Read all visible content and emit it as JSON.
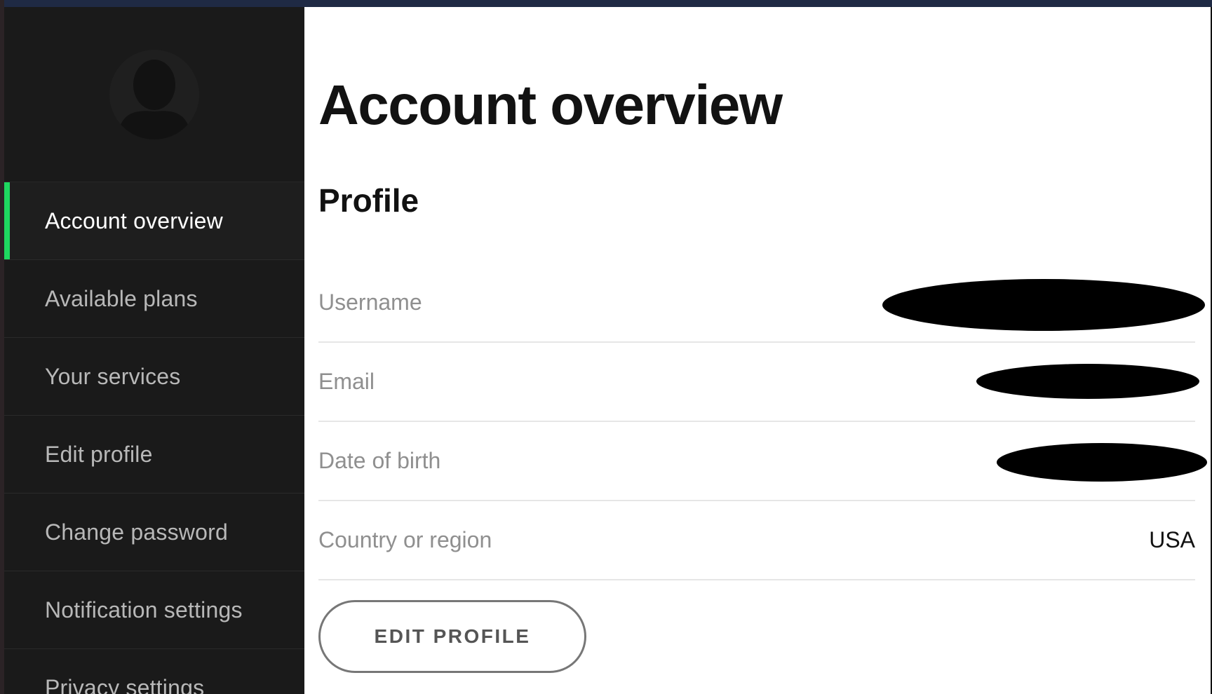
{
  "sidebar": {
    "avatar_icon": "user-silhouette-icon",
    "items": [
      {
        "label": "Account overview",
        "active": true
      },
      {
        "label": "Available plans",
        "active": false
      },
      {
        "label": "Your services",
        "active": false
      },
      {
        "label": "Edit profile",
        "active": false
      },
      {
        "label": "Change password",
        "active": false
      },
      {
        "label": "Notification settings",
        "active": false
      },
      {
        "label": "Privacy settings",
        "active": false
      }
    ]
  },
  "main": {
    "title": "Account overview",
    "profile": {
      "heading": "Profile",
      "rows": [
        {
          "label": "Username",
          "value": "",
          "redacted": true
        },
        {
          "label": "Email",
          "value": "",
          "redacted": true
        },
        {
          "label": "Date of birth",
          "value": "",
          "redacted": true
        },
        {
          "label": "Country or region",
          "value": "USA",
          "redacted": false
        }
      ],
      "edit_button": "EDIT PROFILE"
    }
  },
  "colors": {
    "sidebar_bg": "#1a1a1a",
    "active_accent": "#1ed760",
    "top_strip": "#1f2a44"
  }
}
